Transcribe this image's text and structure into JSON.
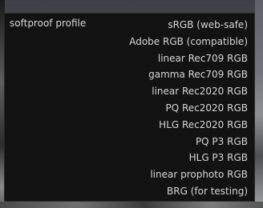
{
  "popup": {
    "label": "softproof profile",
    "options": [
      "sRGB (web-safe)",
      "Adobe RGB (compatible)",
      "linear Rec709 RGB",
      "gamma Rec709 RGB",
      "linear Rec2020 RGB",
      "PQ Rec2020 RGB",
      "HLG Rec2020 RGB",
      "PQ P3 RGB",
      "HLG P3 RGB",
      "linear prophoto RGB",
      "BRG (for testing)"
    ],
    "selected": "sRGB (web-safe)"
  }
}
